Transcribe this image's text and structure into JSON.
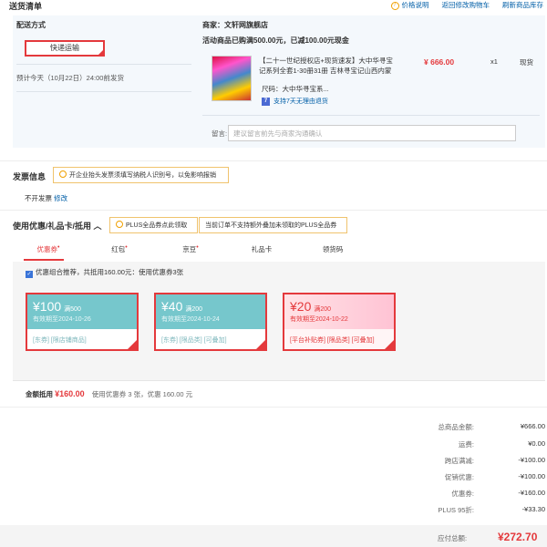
{
  "header": {
    "title": "送货清单",
    "links": [
      "价格说明",
      "返回修改购物车",
      "刷新商品库存"
    ]
  },
  "shipping": {
    "method_label": "配送方式",
    "method_value": "快递运输",
    "eta": "预计今天（10月22日）24:00前发货"
  },
  "merchant": {
    "name": "商家：文轩网旗舰店",
    "promo": "活动商品已购满500.00元，已减100.00元现金"
  },
  "product": {
    "name": "【二十一世纪授权店+现货速发】大中华寻宝记系列全套1-30册31册 吉林寻宝记山西内蒙",
    "price": "¥ 666.00",
    "qty": "x1",
    "stock": "现货",
    "spec": "尺码：大中华寻宝系...",
    "return_policy": "支持7天无理由退货"
  },
  "remark": {
    "label": "留言:",
    "placeholder": "建议留言前先与商家沟通确认"
  },
  "invoice": {
    "title": "发票信息",
    "tip": "开企业抬头发票须填写纳税人识别号，以免影响报销",
    "value": "不开发票",
    "edit": "修改"
  },
  "coupons": {
    "title": "使用优惠/礼品卡/抵用",
    "tip_plus": "PLUS全品券点此领取",
    "tip_note": "当前订单不支持额外叠加未领取的PLUS全品券",
    "tabs": [
      {
        "label": "优惠券",
        "dot": "•"
      },
      {
        "label": "红包",
        "dot": "•"
      },
      {
        "label": "京豆",
        "dot": "•"
      },
      {
        "label": "礼品卡",
        "dot": ""
      },
      {
        "label": "领货码",
        "dot": ""
      }
    ],
    "combo": "优惠组合推荐，共抵用160.00元：使用优惠券3张",
    "list": [
      {
        "amount": "¥100",
        "cond": "满500",
        "expiry": "有效期至2024-10-26",
        "tags": "[东券] [限店铺商品]",
        "style": "teal"
      },
      {
        "amount": "¥40",
        "cond": "满200",
        "expiry": "有效期至2024-10-24",
        "tags": "[东券] [限品类] [可叠加]",
        "style": "teal"
      },
      {
        "amount": "¥20",
        "cond": "满200",
        "expiry": "有效期至2024-10-22",
        "tags": "[平台补贴券] [限品类] [可叠加]",
        "style": "pink"
      }
    ],
    "deduct_label": "金额抵用",
    "deduct_value": "¥160.00",
    "deduct_note": "使用优惠券 3 张，优惠 160.00 元"
  },
  "summary": [
    {
      "k": "总商品金额:",
      "v": "¥666.00"
    },
    {
      "k": "运费:",
      "v": "¥0.00"
    },
    {
      "k": "跨店满减:",
      "v": "-¥100.00"
    },
    {
      "k": "促销优惠:",
      "v": "-¥100.00"
    },
    {
      "k": "优惠券:",
      "v": "-¥160.00"
    },
    {
      "k": "PLUS 95折:",
      "v": "-¥33.30"
    }
  ],
  "total": {
    "label": "应付总额:",
    "value": "¥272.70"
  }
}
